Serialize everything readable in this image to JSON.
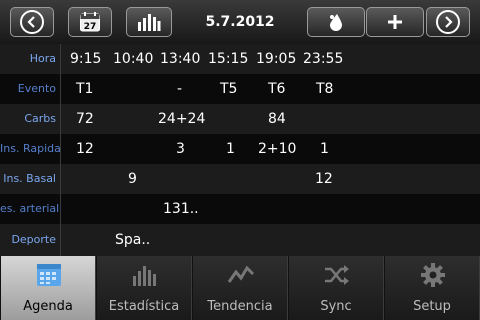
{
  "toolbar": {
    "date": "5.7.2012",
    "calendar_day": "27",
    "buttons": {
      "prev": "chevron-left-icon",
      "calendar": "calendar-icon",
      "stats": "bar-chart-icon",
      "drop": "drop-icon",
      "add": "plus-icon",
      "next": "chevron-right-icon"
    }
  },
  "table": {
    "row_labels": [
      "Hora",
      "Evento",
      "Carbs",
      "Ins. Rapida",
      "Ins. Basal",
      "es. arterial",
      "Deporte"
    ],
    "times": [
      "9:15",
      "10:40",
      "13:40",
      "15:15",
      "19:05",
      "23:55"
    ],
    "evento": [
      "T1",
      "",
      "-",
      "T5",
      "T6",
      "T8"
    ],
    "carbs": [
      "72",
      "",
      "24+24",
      "",
      "84",
      ""
    ],
    "ins_rapida": [
      "12",
      "",
      "3",
      "1",
      "2+10",
      "1"
    ],
    "ins_basal": [
      "",
      "9",
      "",
      "",
      "",
      "12"
    ],
    "pres_arterial": [
      "",
      "",
      "131..",
      "",
      "",
      ""
    ],
    "deporte": [
      "",
      "Spa..",
      "",
      "",
      "",
      ""
    ]
  },
  "tabs": [
    {
      "label": "Agenda",
      "icon": "calendar-icon",
      "active": true
    },
    {
      "label": "Estadística",
      "icon": "bar-chart-icon",
      "active": false
    },
    {
      "label": "Tendencia",
      "icon": "trend-line-icon",
      "active": false
    },
    {
      "label": "Sync",
      "icon": "shuffle-icon",
      "active": false
    },
    {
      "label": "Setup",
      "icon": "gear-icon",
      "active": false
    }
  ],
  "colors": {
    "row_label": "#7aa6ee",
    "background": "#000000",
    "active_tab": "#c4c4c4"
  }
}
